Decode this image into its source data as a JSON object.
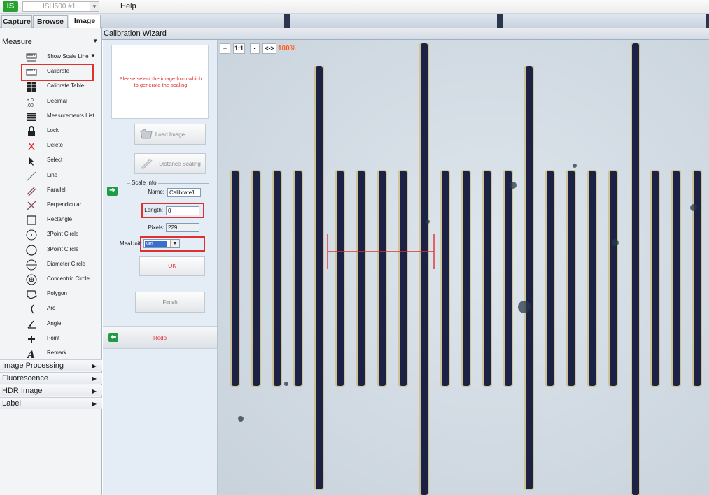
{
  "menubar": {
    "logo": "IS",
    "camera": "ISH500 #1",
    "help": "Help"
  },
  "tabs": [
    "Capture",
    "Browse",
    "Image"
  ],
  "measure_section": "Measure",
  "tools": [
    {
      "label": "Show Scale Line",
      "icon": "scale-line-icon",
      "dropdown": true
    },
    {
      "label": "Calibrate",
      "icon": "calibrate-icon",
      "highlighted": true
    },
    {
      "label": "Calibrate Table",
      "icon": "calibrate-table-icon"
    },
    {
      "label": "Decimal",
      "icon": "decimal-icon"
    },
    {
      "label": "Measurements List",
      "icon": "measurements-list-icon"
    },
    {
      "label": "Lock",
      "icon": "lock-icon"
    },
    {
      "label": "Delete",
      "icon": "delete-icon"
    },
    {
      "label": "Select",
      "icon": "select-arrow-icon"
    },
    {
      "label": "Line",
      "icon": "line-icon"
    },
    {
      "label": "Parallel",
      "icon": "parallel-icon"
    },
    {
      "label": "Perpendicular",
      "icon": "perpendicular-icon"
    },
    {
      "label": "Rectangle",
      "icon": "rectangle-icon"
    },
    {
      "label": "2Point Circle",
      "icon": "two-point-circle-icon"
    },
    {
      "label": "3Point Circle",
      "icon": "three-point-circle-icon"
    },
    {
      "label": "Diameter Circle",
      "icon": "diameter-circle-icon"
    },
    {
      "label": "Concentric Circle",
      "icon": "concentric-circle-icon"
    },
    {
      "label": "Polygon",
      "icon": "polygon-icon"
    },
    {
      "label": "Arc",
      "icon": "arc-icon"
    },
    {
      "label": "Angle",
      "icon": "angle-icon"
    },
    {
      "label": "Point",
      "icon": "point-icon"
    },
    {
      "label": "Remark",
      "icon": "remark-icon"
    }
  ],
  "sections": [
    "Image Processing",
    "Fluorescence",
    "HDR Image",
    "Label"
  ],
  "wizard": {
    "title": "Calibration Wizard",
    "prompt": "Please select the image from which to generate the scaling",
    "load_image": "Load Image",
    "distance_scaling": "Distance Scaling",
    "scale_info": {
      "legend": "Scale Info",
      "name_label": "Name:",
      "name_value": "Calibrate1",
      "length_label": "Length:",
      "length_value": "0",
      "pixels_label": "Pixels:",
      "pixels_value": "229",
      "unit_label": "MeaUnit:",
      "unit_value": "um"
    },
    "ok": "OK",
    "finish": "Finish",
    "redo": "Redo"
  },
  "zoom": {
    "plus": "+",
    "one_to_one": "1:1",
    "minus": "-",
    "fit": "<->",
    "level": "100%"
  },
  "colors": {
    "highlight": "#e03030",
    "accent_green": "#1f9a46",
    "zoom_orange": "#ff5a1e"
  }
}
